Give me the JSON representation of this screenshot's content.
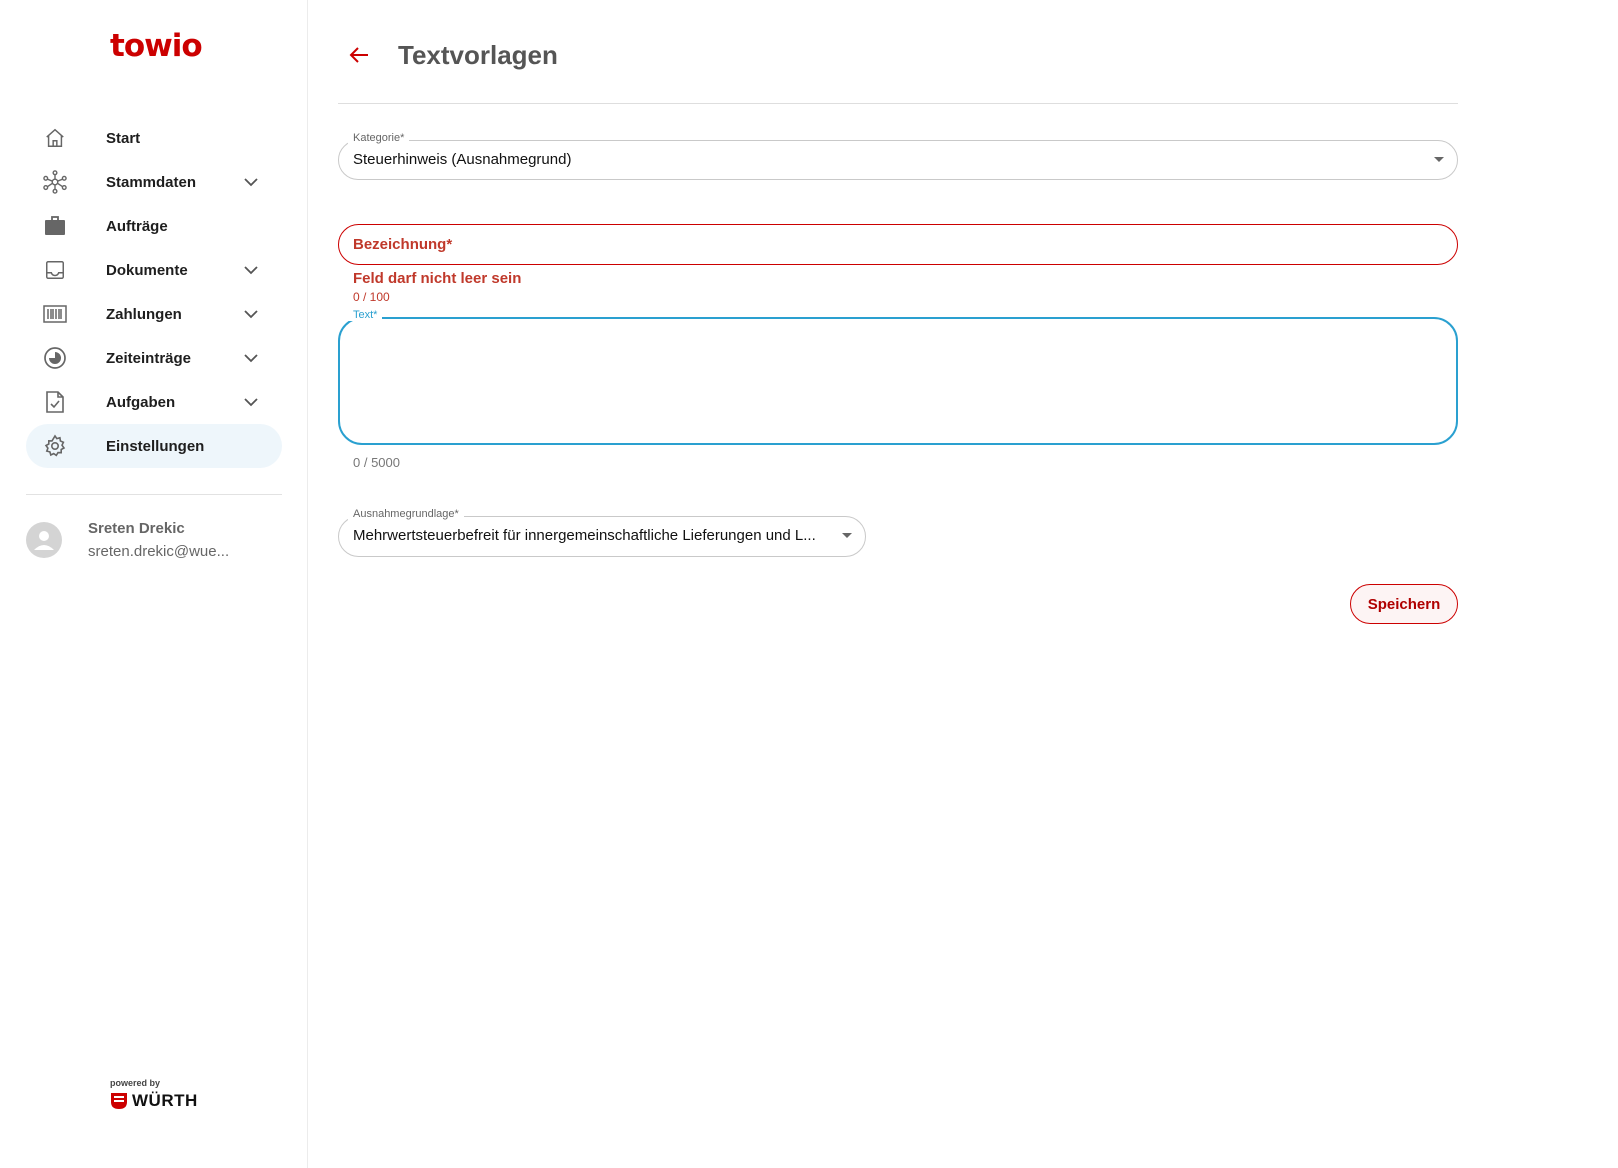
{
  "app": {
    "logo": "towio",
    "brand_color": "#cc0000",
    "accent_color": "#2aa0d0"
  },
  "sidebar": {
    "items": [
      {
        "label": "Start",
        "icon": "home-icon",
        "has_chevron": false
      },
      {
        "label": "Stammdaten",
        "icon": "network-icon",
        "has_chevron": true
      },
      {
        "label": "Aufträge",
        "icon": "briefcase-icon",
        "has_chevron": false
      },
      {
        "label": "Dokumente",
        "icon": "inbox-icon",
        "has_chevron": true
      },
      {
        "label": "Zahlungen",
        "icon": "barcode-icon",
        "has_chevron": true
      },
      {
        "label": "Zeiteinträge",
        "icon": "clock-icon",
        "has_chevron": true
      },
      {
        "label": "Aufgaben",
        "icon": "task-document-icon",
        "has_chevron": true
      },
      {
        "label": "Einstellungen",
        "icon": "gear-icon",
        "has_chevron": false,
        "active": true
      }
    ],
    "user": {
      "name": "Sreten Drekic",
      "email": "sreten.drekic@wue..."
    },
    "footer": {
      "powered_by": "powered by",
      "brand": "WÜRTH"
    }
  },
  "main": {
    "title": "Textvorlagen",
    "form": {
      "kategorie": {
        "label": "Kategorie*",
        "value": "Steuerhinweis (Ausnahmegrund)"
      },
      "bezeichnung": {
        "label": "Bezeichnung*",
        "error": "Feld darf nicht leer sein",
        "counter": "0 / 100",
        "value": ""
      },
      "text": {
        "label": "Text*",
        "counter": "0 / 5000",
        "value": ""
      },
      "ausnahmegrundlage": {
        "label": "Ausnahmegrundlage*",
        "value": "Mehrwertsteuerbefreit für innergemeinschaftliche Lieferungen und L..."
      },
      "save_label": "Speichern"
    }
  }
}
